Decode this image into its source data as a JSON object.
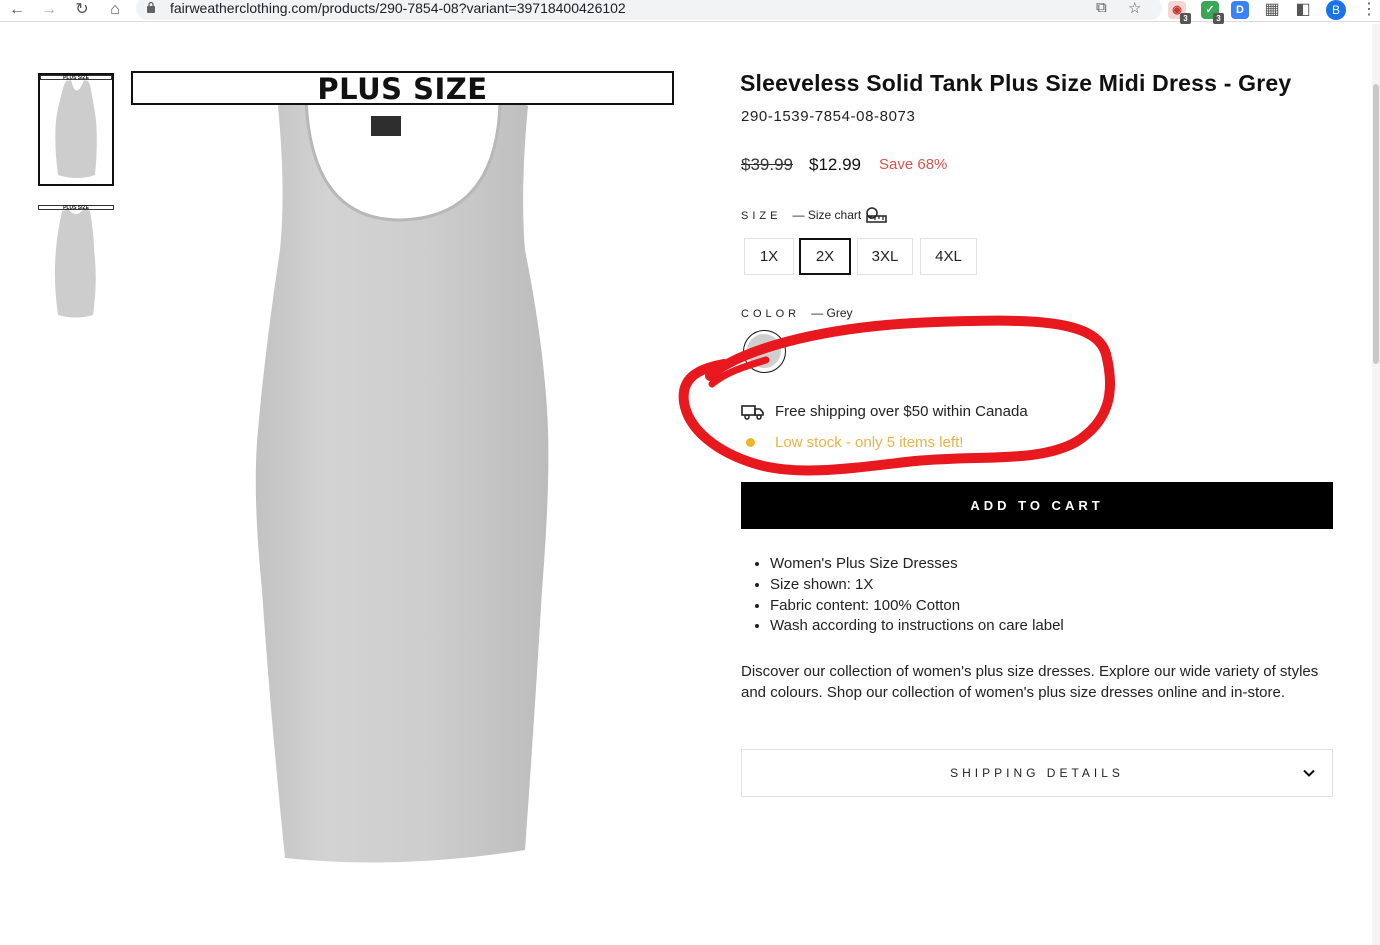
{
  "browser": {
    "url": "fairweatherclothing.com/products/290-7854-08?variant=39718400426102",
    "extensions": [
      {
        "name": "ext-red",
        "badge": "3",
        "color": "#e0574f"
      },
      {
        "name": "ext-green",
        "badge": "3",
        "color": "#3aa757"
      },
      {
        "name": "ext-blue",
        "letter": "D",
        "color": "#3b82f6"
      }
    ],
    "profile_letter": "B"
  },
  "gallery": {
    "banner_text": "PLUS SIZE",
    "thumb_banner_text": "PLUS SIZE"
  },
  "product": {
    "title": "Sleeveless Solid Tank Plus Size Midi Dress - Grey",
    "sku": "290-1539-7854-08-8073",
    "price_original": "$39.99",
    "price_sale": "$12.99",
    "price_save": "Save 68%",
    "size_label": "SIZE",
    "size_chart_label": "— Size chart",
    "sizes": [
      "1X",
      "2X",
      "3XL",
      "4XL"
    ],
    "selected_size": "2X",
    "color_label": "COLOR",
    "color_value": "— Grey",
    "swatch_color": "#cfcfcf",
    "shipping_text": "Free shipping over $50 within Canada",
    "stock_text": "Low stock - only 5 items left!",
    "add_to_cart": "ADD TO CART",
    "features": [
      "Women's Plus Size Dresses",
      "Size shown: 1X",
      "Fabric content: 100% Cotton",
      "Wash according to instructions on care label"
    ],
    "description": "Discover our collection of women's plus size dresses. Explore our wide variety of styles and colours. Shop our collection of women's plus size dresses online and in-store.",
    "shipping_details_label": "SHIPPING DETAILS"
  },
  "colors": {
    "sale_red": "#d9534f",
    "stock_amber": "#e8b447",
    "annotation_red": "#e8181f"
  }
}
